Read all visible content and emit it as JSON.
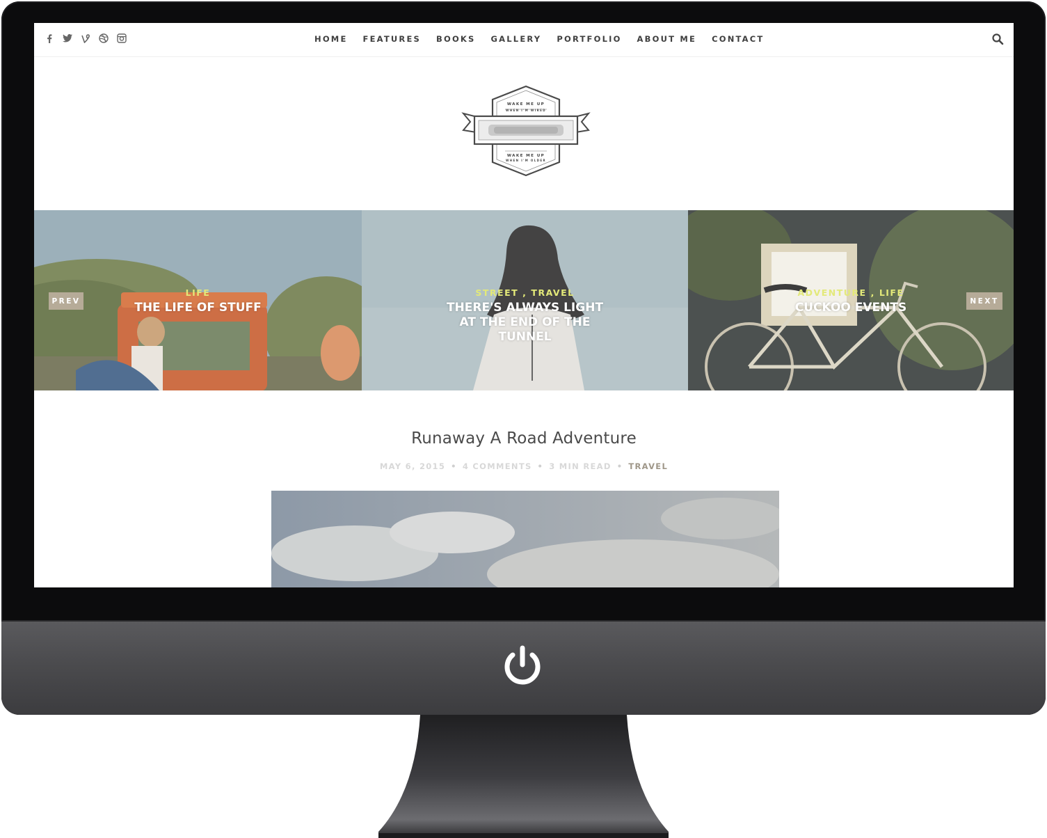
{
  "nav": {
    "items": [
      "HOME",
      "FEATURES",
      "BOOKS",
      "GALLERY",
      "PORTFOLIO",
      "ABOUT ME",
      "CONTACT"
    ],
    "social_icons": [
      "facebook-icon",
      "twitter-icon",
      "vine-icon",
      "dribbble-icon",
      "instagram-icon"
    ],
    "search_icon": "search-icon"
  },
  "logo": {
    "top_line1": "WAKE ME UP",
    "top_line2": "WHEN I'M WIRED",
    "bottom_line1": "WAKE ME UP",
    "bottom_line2": "WHEN I'M OLDER"
  },
  "slider": {
    "prev_label": "PREV",
    "next_label": "NEXT",
    "slides": [
      {
        "categories": [
          "LIFE"
        ],
        "title": "THE LIFE OF STUFF"
      },
      {
        "categories": [
          "STREET",
          "TRAVEL"
        ],
        "title": "THERE'S ALWAYS LIGHT AT THE END OF THE TUNNEL"
      },
      {
        "categories": [
          "ADVENTURE",
          "LIFE"
        ],
        "title": "CUCKOO EVENTS"
      }
    ],
    "category_color": "#e3e979"
  },
  "post": {
    "title": "Runaway A Road Adventure",
    "date": "MAY 6, 2015",
    "comments": "4 COMMENTS",
    "read_time": "3 MIN READ",
    "category": "TRAVEL",
    "category_color": "#9f9789"
  },
  "monitor": {
    "power_icon": "power-icon"
  }
}
